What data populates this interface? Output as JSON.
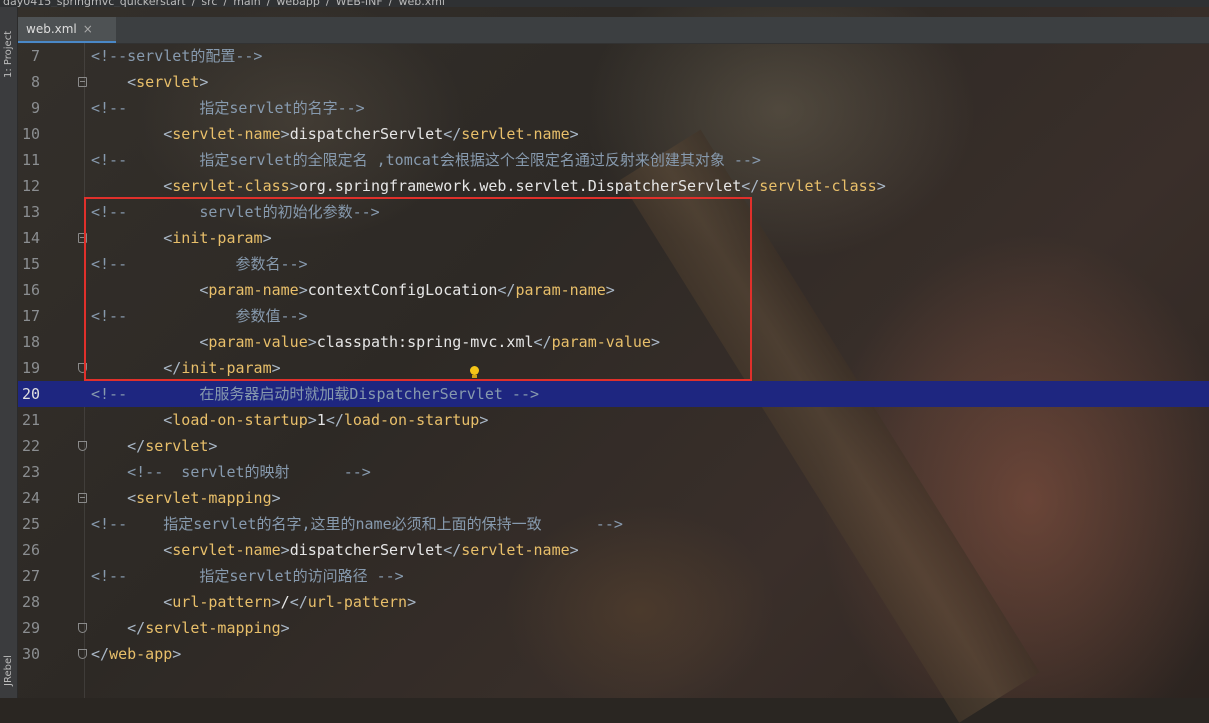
{
  "breadcrumb": [
    "day0415_springmvc_quickerstart",
    "src",
    "main",
    "webapp",
    "WEB-INF",
    "web.xml"
  ],
  "sidebar": {
    "project_tab": "1: Project",
    "jrebel_tab": "JRebel"
  },
  "tab": {
    "label": "web.xml",
    "close": "×"
  },
  "lines": [
    {
      "n": "7",
      "indent": "",
      "parts": [
        [
          "c",
          "<!--servlet的配置-->"
        ]
      ]
    },
    {
      "n": "8",
      "indent": "    ",
      "parts": [
        [
          "b",
          "<"
        ],
        [
          "t",
          "servlet"
        ],
        [
          "b",
          ">"
        ]
      ]
    },
    {
      "n": "9",
      "indent": "",
      "parts": [
        [
          "c",
          "<!--        指定servlet的名字-->"
        ]
      ]
    },
    {
      "n": "10",
      "indent": "        ",
      "parts": [
        [
          "b",
          "<"
        ],
        [
          "t",
          "servlet-name"
        ],
        [
          "b",
          ">"
        ],
        [
          "x",
          "dispatcherServlet"
        ],
        [
          "b",
          "</"
        ],
        [
          "t",
          "servlet-name"
        ],
        [
          "b",
          ">"
        ]
      ]
    },
    {
      "n": "11",
      "indent": "",
      "parts": [
        [
          "c",
          "<!--        指定servlet的全限定名 ,tomcat会根据这个全限定名通过反射来创建其对象 -->"
        ]
      ]
    },
    {
      "n": "12",
      "indent": "        ",
      "parts": [
        [
          "b",
          "<"
        ],
        [
          "t",
          "servlet-class"
        ],
        [
          "b",
          ">"
        ],
        [
          "x",
          "org.springframework.web.servlet.DispatcherServlet"
        ],
        [
          "b",
          "</"
        ],
        [
          "t",
          "servlet-class"
        ],
        [
          "b",
          ">"
        ]
      ]
    },
    {
      "n": "13",
      "indent": "",
      "parts": [
        [
          "c",
          "<!--        servlet的初始化参数-->"
        ]
      ]
    },
    {
      "n": "14",
      "indent": "        ",
      "parts": [
        [
          "b",
          "<"
        ],
        [
          "t",
          "init-param"
        ],
        [
          "b",
          ">"
        ]
      ]
    },
    {
      "n": "15",
      "indent": "",
      "parts": [
        [
          "c",
          "<!--            参数名-->"
        ]
      ]
    },
    {
      "n": "16",
      "indent": "            ",
      "parts": [
        [
          "b",
          "<"
        ],
        [
          "t",
          "param-name"
        ],
        [
          "b",
          ">"
        ],
        [
          "x",
          "contextConfigLocation"
        ],
        [
          "b",
          "</"
        ],
        [
          "t",
          "param-name"
        ],
        [
          "b",
          ">"
        ]
      ]
    },
    {
      "n": "17",
      "indent": "",
      "parts": [
        [
          "c",
          "<!--            参数值-->"
        ]
      ]
    },
    {
      "n": "18",
      "indent": "            ",
      "parts": [
        [
          "b",
          "<"
        ],
        [
          "t",
          "param-value"
        ],
        [
          "b",
          ">"
        ],
        [
          "x",
          "classpath:spring-mvc.xml"
        ],
        [
          "b",
          "</"
        ],
        [
          "t",
          "param-value"
        ],
        [
          "b",
          ">"
        ]
      ]
    },
    {
      "n": "19",
      "indent": "        ",
      "parts": [
        [
          "b",
          "</"
        ],
        [
          "t",
          "init-param"
        ],
        [
          "b",
          ">"
        ]
      ]
    },
    {
      "n": "20",
      "indent": "",
      "parts": [
        [
          "c",
          "<!--        在服务器启动时就加载DispatcherServlet -->"
        ]
      ]
    },
    {
      "n": "21",
      "indent": "        ",
      "parts": [
        [
          "b",
          "<"
        ],
        [
          "t",
          "load-on-startup"
        ],
        [
          "b",
          ">"
        ],
        [
          "x",
          "1"
        ],
        [
          "b",
          "</"
        ],
        [
          "t",
          "load-on-startup"
        ],
        [
          "b",
          ">"
        ]
      ]
    },
    {
      "n": "22",
      "indent": "    ",
      "parts": [
        [
          "b",
          "</"
        ],
        [
          "t",
          "servlet"
        ],
        [
          "b",
          ">"
        ]
      ]
    },
    {
      "n": "23",
      "indent": "    ",
      "parts": [
        [
          "c",
          "<!--  servlet的映射      -->"
        ]
      ]
    },
    {
      "n": "24",
      "indent": "    ",
      "parts": [
        [
          "b",
          "<"
        ],
        [
          "t",
          "servlet-mapping"
        ],
        [
          "b",
          ">"
        ]
      ]
    },
    {
      "n": "25",
      "indent": "",
      "parts": [
        [
          "c",
          "<!--    指定servlet的名字,这里的name必须和上面的保持一致      -->"
        ]
      ]
    },
    {
      "n": "26",
      "indent": "        ",
      "parts": [
        [
          "b",
          "<"
        ],
        [
          "t",
          "servlet-name"
        ],
        [
          "b",
          ">"
        ],
        [
          "x",
          "dispatcherServlet"
        ],
        [
          "b",
          "</"
        ],
        [
          "t",
          "servlet-name"
        ],
        [
          "b",
          ">"
        ]
      ]
    },
    {
      "n": "27",
      "indent": "",
      "parts": [
        [
          "c",
          "<!--        指定servlet的访问路径 -->"
        ]
      ]
    },
    {
      "n": "28",
      "indent": "        ",
      "parts": [
        [
          "b",
          "<"
        ],
        [
          "t",
          "url-pattern"
        ],
        [
          "b",
          ">"
        ],
        [
          "x",
          "/"
        ],
        [
          "b",
          "</"
        ],
        [
          "t",
          "url-pattern"
        ],
        [
          "b",
          ">"
        ]
      ]
    },
    {
      "n": "29",
      "indent": "    ",
      "parts": [
        [
          "b",
          "</"
        ],
        [
          "t",
          "servlet-mapping"
        ],
        [
          "b",
          ">"
        ]
      ]
    },
    {
      "n": "30",
      "indent": "",
      "parts": [
        [
          "b",
          "</"
        ],
        [
          "t",
          "web-app"
        ],
        [
          "b",
          ">"
        ]
      ]
    }
  ],
  "current_line": "20",
  "fold_markers": {
    "8": "open",
    "14": "open",
    "19": "end",
    "22": "end",
    "24": "open",
    "29": "end",
    "30": "end"
  },
  "colors": {
    "comment": "#879aae",
    "tag": "#e8bf6a",
    "bracket": "#a9b7c6",
    "text": "#e6e6e6",
    "current_line_bg": "#1e2680",
    "highlight_box": "#e0302b"
  }
}
